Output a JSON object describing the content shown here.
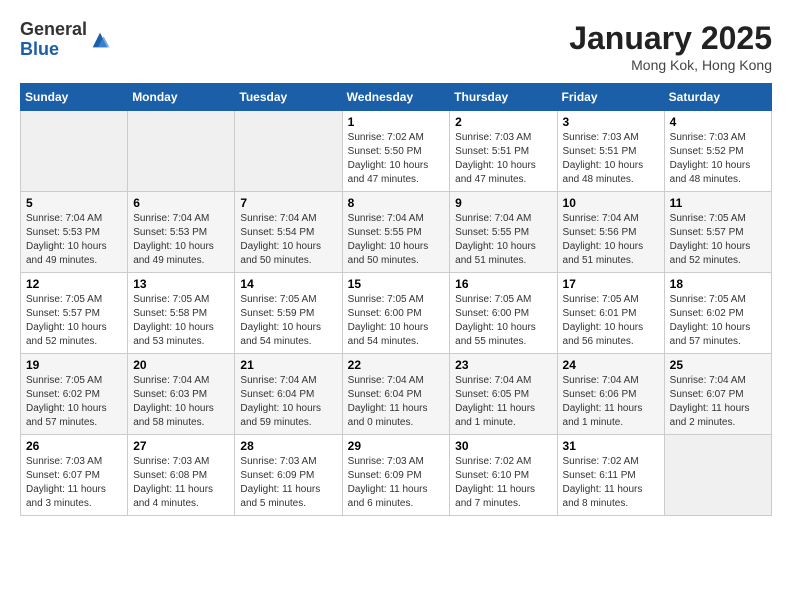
{
  "header": {
    "logo_general": "General",
    "logo_blue": "Blue",
    "month_title": "January 2025",
    "location": "Mong Kok, Hong Kong"
  },
  "days_of_week": [
    "Sunday",
    "Monday",
    "Tuesday",
    "Wednesday",
    "Thursday",
    "Friday",
    "Saturday"
  ],
  "weeks": [
    [
      {
        "day": "",
        "info": ""
      },
      {
        "day": "",
        "info": ""
      },
      {
        "day": "",
        "info": ""
      },
      {
        "day": "1",
        "info": "Sunrise: 7:02 AM\nSunset: 5:50 PM\nDaylight: 10 hours\nand 47 minutes."
      },
      {
        "day": "2",
        "info": "Sunrise: 7:03 AM\nSunset: 5:51 PM\nDaylight: 10 hours\nand 47 minutes."
      },
      {
        "day": "3",
        "info": "Sunrise: 7:03 AM\nSunset: 5:51 PM\nDaylight: 10 hours\nand 48 minutes."
      },
      {
        "day": "4",
        "info": "Sunrise: 7:03 AM\nSunset: 5:52 PM\nDaylight: 10 hours\nand 48 minutes."
      }
    ],
    [
      {
        "day": "5",
        "info": "Sunrise: 7:04 AM\nSunset: 5:53 PM\nDaylight: 10 hours\nand 49 minutes."
      },
      {
        "day": "6",
        "info": "Sunrise: 7:04 AM\nSunset: 5:53 PM\nDaylight: 10 hours\nand 49 minutes."
      },
      {
        "day": "7",
        "info": "Sunrise: 7:04 AM\nSunset: 5:54 PM\nDaylight: 10 hours\nand 50 minutes."
      },
      {
        "day": "8",
        "info": "Sunrise: 7:04 AM\nSunset: 5:55 PM\nDaylight: 10 hours\nand 50 minutes."
      },
      {
        "day": "9",
        "info": "Sunrise: 7:04 AM\nSunset: 5:55 PM\nDaylight: 10 hours\nand 51 minutes."
      },
      {
        "day": "10",
        "info": "Sunrise: 7:04 AM\nSunset: 5:56 PM\nDaylight: 10 hours\nand 51 minutes."
      },
      {
        "day": "11",
        "info": "Sunrise: 7:05 AM\nSunset: 5:57 PM\nDaylight: 10 hours\nand 52 minutes."
      }
    ],
    [
      {
        "day": "12",
        "info": "Sunrise: 7:05 AM\nSunset: 5:57 PM\nDaylight: 10 hours\nand 52 minutes."
      },
      {
        "day": "13",
        "info": "Sunrise: 7:05 AM\nSunset: 5:58 PM\nDaylight: 10 hours\nand 53 minutes."
      },
      {
        "day": "14",
        "info": "Sunrise: 7:05 AM\nSunset: 5:59 PM\nDaylight: 10 hours\nand 54 minutes."
      },
      {
        "day": "15",
        "info": "Sunrise: 7:05 AM\nSunset: 6:00 PM\nDaylight: 10 hours\nand 54 minutes."
      },
      {
        "day": "16",
        "info": "Sunrise: 7:05 AM\nSunset: 6:00 PM\nDaylight: 10 hours\nand 55 minutes."
      },
      {
        "day": "17",
        "info": "Sunrise: 7:05 AM\nSunset: 6:01 PM\nDaylight: 10 hours\nand 56 minutes."
      },
      {
        "day": "18",
        "info": "Sunrise: 7:05 AM\nSunset: 6:02 PM\nDaylight: 10 hours\nand 57 minutes."
      }
    ],
    [
      {
        "day": "19",
        "info": "Sunrise: 7:05 AM\nSunset: 6:02 PM\nDaylight: 10 hours\nand 57 minutes."
      },
      {
        "day": "20",
        "info": "Sunrise: 7:04 AM\nSunset: 6:03 PM\nDaylight: 10 hours\nand 58 minutes."
      },
      {
        "day": "21",
        "info": "Sunrise: 7:04 AM\nSunset: 6:04 PM\nDaylight: 10 hours\nand 59 minutes."
      },
      {
        "day": "22",
        "info": "Sunrise: 7:04 AM\nSunset: 6:04 PM\nDaylight: 11 hours\nand 0 minutes."
      },
      {
        "day": "23",
        "info": "Sunrise: 7:04 AM\nSunset: 6:05 PM\nDaylight: 11 hours\nand 1 minute."
      },
      {
        "day": "24",
        "info": "Sunrise: 7:04 AM\nSunset: 6:06 PM\nDaylight: 11 hours\nand 1 minute."
      },
      {
        "day": "25",
        "info": "Sunrise: 7:04 AM\nSunset: 6:07 PM\nDaylight: 11 hours\nand 2 minutes."
      }
    ],
    [
      {
        "day": "26",
        "info": "Sunrise: 7:03 AM\nSunset: 6:07 PM\nDaylight: 11 hours\nand 3 minutes."
      },
      {
        "day": "27",
        "info": "Sunrise: 7:03 AM\nSunset: 6:08 PM\nDaylight: 11 hours\nand 4 minutes."
      },
      {
        "day": "28",
        "info": "Sunrise: 7:03 AM\nSunset: 6:09 PM\nDaylight: 11 hours\nand 5 minutes."
      },
      {
        "day": "29",
        "info": "Sunrise: 7:03 AM\nSunset: 6:09 PM\nDaylight: 11 hours\nand 6 minutes."
      },
      {
        "day": "30",
        "info": "Sunrise: 7:02 AM\nSunset: 6:10 PM\nDaylight: 11 hours\nand 7 minutes."
      },
      {
        "day": "31",
        "info": "Sunrise: 7:02 AM\nSunset: 6:11 PM\nDaylight: 11 hours\nand 8 minutes."
      },
      {
        "day": "",
        "info": ""
      }
    ]
  ]
}
